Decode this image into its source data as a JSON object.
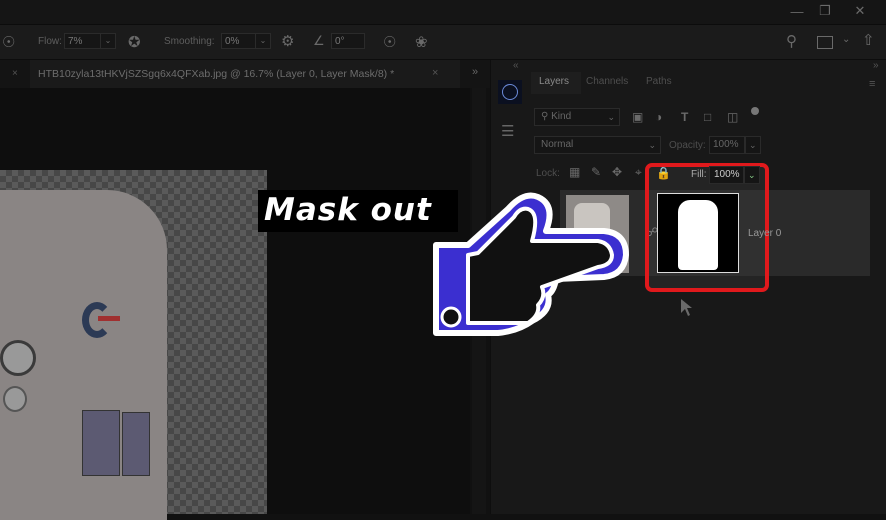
{
  "window": {
    "controls": {
      "minimize_icon": "minimize-icon",
      "restore_icon": "restore-icon",
      "close_icon": "close-icon"
    }
  },
  "options_bar": {
    "flow_label": "Flow:",
    "flow_value": "7%",
    "smoothing_label": "Smoothing:",
    "smoothing_value": "0%",
    "angle_value": "0°",
    "icons": [
      "brush-pressure-icon",
      "airbrush-icon",
      "gear-icon",
      "angle-icon",
      "pressure-size-icon",
      "symmetry-icon",
      "search-icon",
      "workspace-icon",
      "share-icon"
    ]
  },
  "document": {
    "tab_title": "HTB10zyla13tHKVjSZSgq6x4QFXab.jpg @ 16.7% (Layer 0, Layer Mask/8) *",
    "close_label": "×"
  },
  "annotation": {
    "caption": "Mask out",
    "pointer_icon": "pointing-hand-icon",
    "highlight_color": "#e0191c",
    "hand_color": "#3b2fd0"
  },
  "layers_panel": {
    "tabs": [
      {
        "label": "Layers",
        "active": true
      },
      {
        "label": "Channels",
        "active": false
      },
      {
        "label": "Paths",
        "active": false
      }
    ],
    "filter_kind": "Kind",
    "blend_mode": "Normal",
    "opacity_label": "Opacity:",
    "opacity_value": "100%",
    "lock_label": "Lock:",
    "fill_label": "Fill:",
    "fill_value": "100%",
    "layers": [
      {
        "name": "Layer 0",
        "has_mask": true
      }
    ]
  }
}
